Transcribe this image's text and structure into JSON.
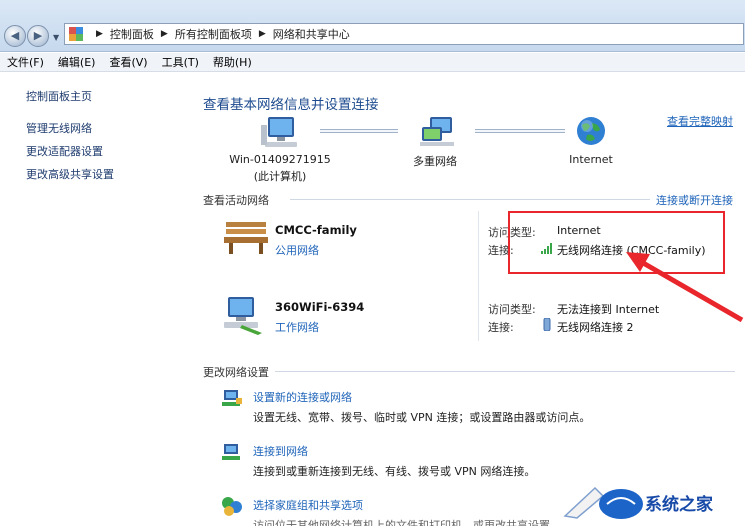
{
  "breadcrumb": [
    "控制面板",
    "所有控制面板项",
    "网络和共享中心"
  ],
  "menu": [
    "文件(F)",
    "编辑(E)",
    "查看(V)",
    "工具(T)",
    "帮助(H)"
  ],
  "sidebar": {
    "home": "控制面板主页",
    "links": [
      "管理无线网络",
      "更改适配器设置",
      "更改高级共享设置"
    ]
  },
  "main": {
    "title": "查看基本网络信息并设置连接",
    "see_full_map": "查看完整映射",
    "map": {
      "computer_name": "Win-01409271915",
      "computer_sub": "(此计算机)",
      "middle": "多重网络",
      "internet": "Internet"
    },
    "active_title": "查看活动网络",
    "connect_disconnect": "连接或断开连接",
    "networks": [
      {
        "name": "CMCC-family",
        "type": "公用网络",
        "access_label": "访问类型:",
        "access_value": "Internet",
        "conn_label": "连接:",
        "conn_value": "无线网络连接 (CMCC-family)"
      },
      {
        "name": "360WiFi-6394",
        "type": "工作网络",
        "access_label": "访问类型:",
        "access_value": "无法连接到 Internet",
        "conn_label": "连接:",
        "conn_value": "无线网络连接 2"
      }
    ],
    "change_title": "更改网络设置",
    "tasks": [
      {
        "title": "设置新的连接或网络",
        "desc": "设置无线、宽带、拨号、临时或 VPN 连接；或设置路由器或访问点。"
      },
      {
        "title": "连接到网络",
        "desc": "连接到或重新连接到无线、有线、拨号或 VPN 网络连接。"
      },
      {
        "title": "选择家庭组和共享选项",
        "desc": "访问位于其他网络计算机上的文件和打印机，或更改共享设置"
      }
    ]
  },
  "watermark": {
    "text": "系统之家"
  },
  "colors": {
    "link": "#1f64b9",
    "highlight": "#e8262c"
  }
}
